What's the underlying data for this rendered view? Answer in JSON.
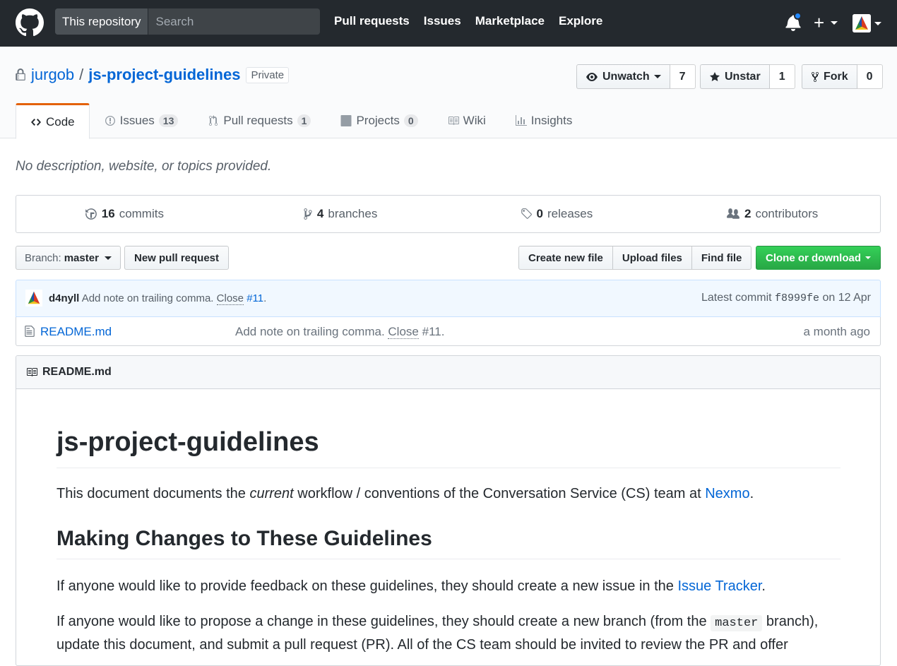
{
  "header": {
    "search_scope": "This repository",
    "search_placeholder": "Search",
    "nav": [
      "Pull requests",
      "Issues",
      "Marketplace",
      "Explore"
    ],
    "plus_label": "+"
  },
  "repo": {
    "owner": "jurgob",
    "separator": "/",
    "name": "js-project-guidelines",
    "visibility": "Private",
    "watch_label": "Unwatch",
    "watch_count": "7",
    "star_label": "Unstar",
    "star_count": "1",
    "fork_label": "Fork",
    "fork_count": "0"
  },
  "tabs": [
    {
      "label": "Code",
      "count": null
    },
    {
      "label": "Issues",
      "count": "13"
    },
    {
      "label": "Pull requests",
      "count": "1"
    },
    {
      "label": "Projects",
      "count": "0"
    },
    {
      "label": "Wiki",
      "count": null
    },
    {
      "label": "Insights",
      "count": null
    }
  ],
  "description": "No description, website, or topics provided.",
  "summary": {
    "commits_num": "16",
    "commits_label": "commits",
    "branches_num": "4",
    "branches_label": "branches",
    "releases_num": "0",
    "releases_label": "releases",
    "contributors_num": "2",
    "contributors_label": "contributors"
  },
  "file_nav": {
    "branch_prefix": "Branch:",
    "branch": "master",
    "new_pr": "New pull request",
    "create_file": "Create new file",
    "upload_files": "Upload files",
    "find_file": "Find file",
    "clone": "Clone or download"
  },
  "commit": {
    "author": "d4nyll",
    "message": "Add note on trailing comma.",
    "close_word": "Close",
    "issue_link": "#11",
    "trailing": ".",
    "latest_label": "Latest commit",
    "sha": "f8999fe",
    "date": "on 12 Apr"
  },
  "files": [
    {
      "name": "README.md",
      "message": "Add note on trailing comma.",
      "close_word": "Close",
      "ref": "#11.",
      "age": "a month ago"
    }
  ],
  "readme": {
    "header": "README.md",
    "h1": "js-project-guidelines",
    "p1_a": "This document documents the ",
    "p1_em": "current",
    "p1_b": " workflow / conventions of the Conversation Service (CS) team at ",
    "p1_link": "Nexmo",
    "p1_end": ".",
    "h2": "Making Changes to These Guidelines",
    "p2_a": "If anyone would like to provide feedback on these guidelines, they should create a new issue in the ",
    "p2_link": "Issue Tracker",
    "p2_end": ".",
    "p3_a": "If anyone would like to propose a change in these guidelines, they should create a new branch (from the ",
    "p3_code": "master",
    "p3_b": " branch), update this document, and submit a pull request (PR). All of the CS team should be invited to review the PR and offer"
  },
  "colors": {
    "header_bg": "#24292e",
    "link": "#0366d6",
    "clone_green": "#28a745",
    "tab_accent": "#e36209",
    "notification_dot": "#2188ff"
  },
  "icons": [
    "github-logo",
    "bell-icon",
    "lock-icon",
    "eye-icon",
    "star-icon",
    "fork-icon",
    "code-icon",
    "issue-icon",
    "pull-request-icon",
    "project-icon",
    "wiki-icon",
    "graph-icon",
    "history-icon",
    "branch-icon",
    "tag-icon",
    "organization-icon",
    "file-icon",
    "book-icon"
  ]
}
